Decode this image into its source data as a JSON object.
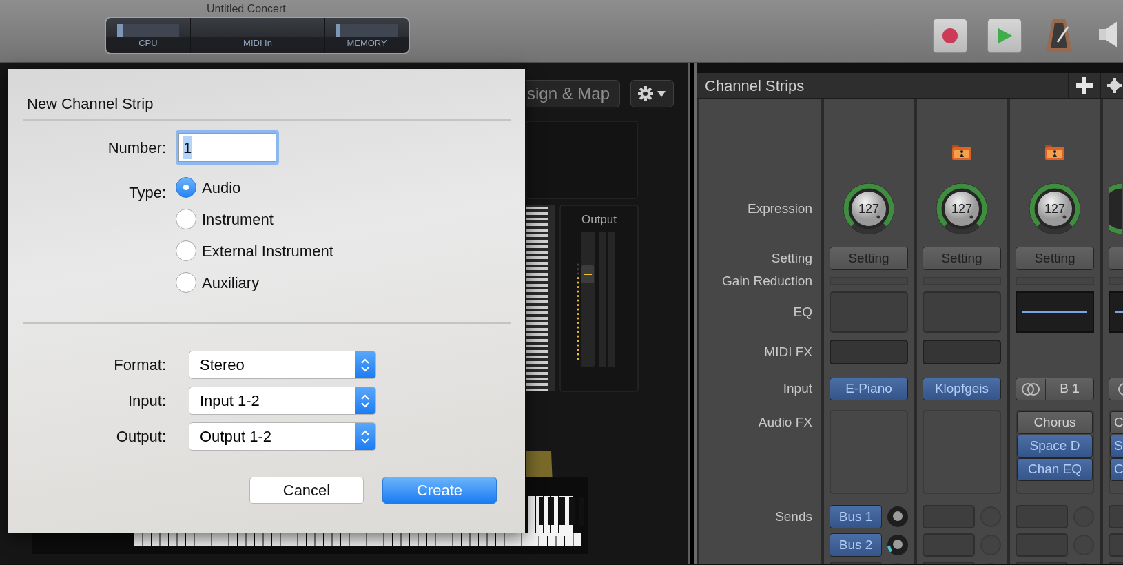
{
  "toolbar": {
    "title": "Untitled Concert",
    "meters": [
      {
        "label": "CPU",
        "level": 0.1
      },
      {
        "label": "MIDI In"
      },
      {
        "label": "MEMORY",
        "level": 0.07
      }
    ]
  },
  "instrument": {
    "tab_label": "sign & Map",
    "output_label": "Output"
  },
  "dialog": {
    "title": "New Channel Strip",
    "number": {
      "label": "Number:",
      "value": "1",
      "text_selected": true
    },
    "type": {
      "label": "Type:",
      "options": [
        {
          "label": "Audio",
          "selected": true
        },
        {
          "label": "Instrument",
          "selected": false
        },
        {
          "label": "External Instrument",
          "selected": false
        },
        {
          "label": "Auxiliary",
          "selected": false
        }
      ]
    },
    "selects": [
      {
        "label": "Format:",
        "value": "Stereo"
      },
      {
        "label": "Input:",
        "value": "Input 1-2"
      },
      {
        "label": "Output:",
        "value": "Output 1-2"
      }
    ],
    "buttons": [
      {
        "label": "Cancel",
        "kind": "secondary"
      },
      {
        "label": "Create",
        "kind": "primary"
      }
    ]
  },
  "channel_strips": {
    "title": "Channel Strips",
    "row_labels": [
      "Expression",
      "Setting",
      "Gain Reduction",
      "EQ",
      "MIDI FX",
      "Input",
      "Audio FX",
      "Sends"
    ],
    "strips": [
      {
        "patch_icon": false,
        "expression": "127",
        "setting": "Setting",
        "eq_active": false,
        "midi_fx_slot": true,
        "input": {
          "kind": "instrument",
          "label": "E-Piano"
        },
        "sends": [
          {
            "label": "Bus 1"
          },
          {
            "label": "Bus 2",
            "level": 0.15
          }
        ]
      },
      {
        "patch_icon": true,
        "expression": "127",
        "setting": "Setting",
        "eq_active": false,
        "midi_fx_slot": true,
        "input": {
          "kind": "instrument",
          "label": "Klopfgeis"
        }
      },
      {
        "patch_icon": true,
        "expression": "127",
        "setting": "Setting",
        "eq_active": true,
        "midi_fx_slot": false,
        "input": {
          "kind": "bus",
          "label": "B 1"
        },
        "audio_fx": [
          {
            "label": "Chorus",
            "bypassed": true
          },
          {
            "label": "Space D",
            "bypassed": false
          },
          {
            "label": "Chan EQ",
            "bypassed": false
          }
        ]
      },
      {
        "patch_icon": false,
        "eq_active": true,
        "midi_fx_slot": false,
        "input": {
          "kind": "bus"
        },
        "audio_fx": [
          {
            "label": "C",
            "bypassed": true
          },
          {
            "label": "S",
            "bypassed": false
          },
          {
            "label": "C",
            "bypassed": false
          }
        ]
      }
    ]
  }
}
